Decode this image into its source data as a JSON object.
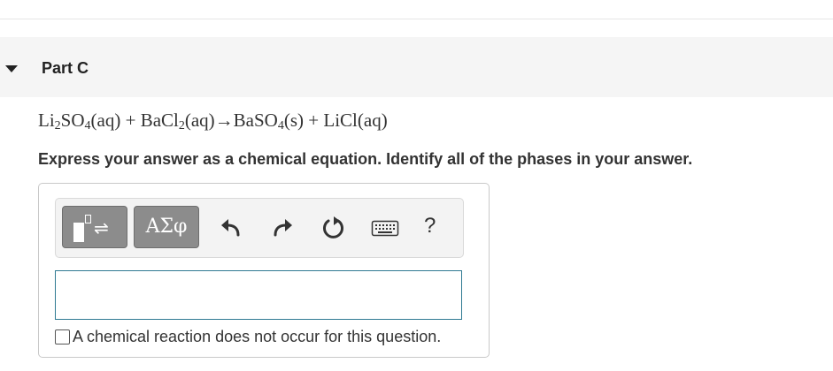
{
  "part": {
    "title": "Part C"
  },
  "equation": {
    "reactant1": {
      "p1": "Li",
      "s1": "2",
      "p2": "SO",
      "s2": "4",
      "phase": "(aq)"
    },
    "plus1": " + ",
    "reactant2": {
      "p1": "BaCl",
      "s1": "2",
      "phase": "(aq)"
    },
    "arrow": "→",
    "product1": {
      "p1": "BaSO",
      "s1": "4",
      "phase": "(s)"
    },
    "plus2": " + ",
    "product2": {
      "p1": "LiCl",
      "phase": "(aq)"
    }
  },
  "instruction": "Express your answer as a chemical equation. Identify all of the phases in your answer.",
  "toolbar": {
    "greek_label": "ΑΣφ",
    "templates_arrows": "⇌",
    "help_label": "?",
    "icons": [
      "templates-icon",
      "undo-icon",
      "redo-icon",
      "reset-icon",
      "keyboard-icon",
      "help-icon"
    ]
  },
  "answer": {
    "value": ""
  },
  "no_reaction": {
    "label": "A chemical reaction does not occur for this question.",
    "checked": false
  },
  "colors": {
    "input_border": "#2f7a92",
    "button_gray": "#8c8c8c",
    "header_bg": "#f5f5f5"
  }
}
